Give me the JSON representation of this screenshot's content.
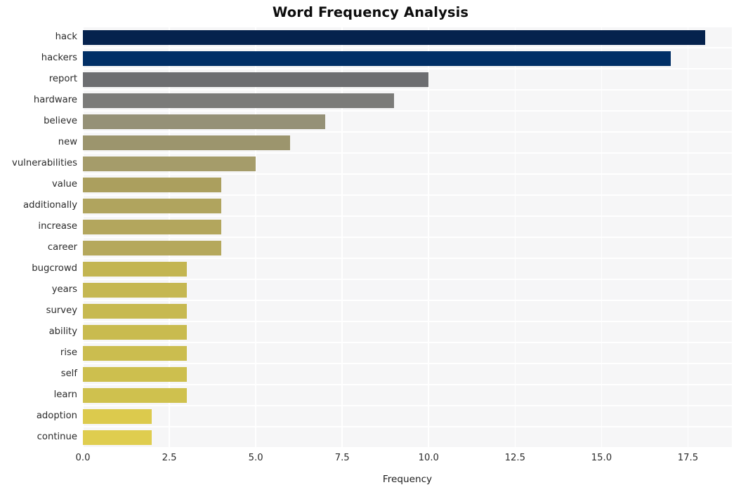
{
  "chart_data": {
    "type": "bar",
    "orientation": "horizontal",
    "title": "Word Frequency Analysis",
    "xlabel": "Frequency",
    "ylabel": "",
    "xlim": [
      0,
      18.77
    ],
    "xticks": [
      0.0,
      2.5,
      5.0,
      7.5,
      10.0,
      12.5,
      15.0,
      17.5
    ],
    "xtick_labels": [
      "0.0",
      "2.5",
      "5.0",
      "7.5",
      "10.0",
      "12.5",
      "15.0",
      "17.5"
    ],
    "grid": true,
    "legend": "none",
    "plot_background": "#f6f6f7",
    "gridline_color": "#ffffff",
    "categories": [
      "hack",
      "hackers",
      "report",
      "hardware",
      "believe",
      "new",
      "vulnerabilities",
      "value",
      "additionally",
      "increase",
      "career",
      "bugcrowd",
      "years",
      "survey",
      "ability",
      "rise",
      "self",
      "learn",
      "adoption",
      "continue"
    ],
    "values": [
      18,
      17,
      10,
      9,
      7,
      6,
      5,
      4,
      4,
      4,
      4,
      3,
      3,
      3,
      3,
      3,
      3,
      3,
      2,
      2
    ],
    "bar_colors": [
      "#05224d",
      "#012f66",
      "#6d6e71",
      "#7b7b79",
      "#959177",
      "#9c956d",
      "#a59c6a",
      "#ab9f5e",
      "#b0a45e",
      "#b3a65d",
      "#b5a85c",
      "#c3b551",
      "#c5b751",
      "#c7b950",
      "#c9bb4f",
      "#cbbd4f",
      "#cdbf4e",
      "#cfc14e",
      "#dcca4d",
      "#dfcd4f"
    ],
    "bars": [
      {
        "label": "hack",
        "value": 18,
        "color": "#05224d"
      },
      {
        "label": "hackers",
        "value": 17,
        "color": "#012f66"
      },
      {
        "label": "report",
        "value": 10,
        "color": "#6d6e71"
      },
      {
        "label": "hardware",
        "value": 9,
        "color": "#7b7b79"
      },
      {
        "label": "believe",
        "value": 7,
        "color": "#959177"
      },
      {
        "label": "new",
        "value": 6,
        "color": "#9c956d"
      },
      {
        "label": "vulnerabilities",
        "value": 5,
        "color": "#a59c6a"
      },
      {
        "label": "value",
        "value": 4,
        "color": "#ab9f5e"
      },
      {
        "label": "additionally",
        "value": 4,
        "color": "#b0a45e"
      },
      {
        "label": "increase",
        "value": 4,
        "color": "#b3a65d"
      },
      {
        "label": "career",
        "value": 4,
        "color": "#b5a85c"
      },
      {
        "label": "bugcrowd",
        "value": 3,
        "color": "#c3b551"
      },
      {
        "label": "years",
        "value": 3,
        "color": "#c5b751"
      },
      {
        "label": "survey",
        "value": 3,
        "color": "#c7b950"
      },
      {
        "label": "ability",
        "value": 3,
        "color": "#c9bb4f"
      },
      {
        "label": "rise",
        "value": 3,
        "color": "#cbbd4f"
      },
      {
        "label": "self",
        "value": 3,
        "color": "#cdbf4e"
      },
      {
        "label": "learn",
        "value": 3,
        "color": "#cfc14e"
      },
      {
        "label": "adoption",
        "value": 2,
        "color": "#dcca4d"
      },
      {
        "label": "continue",
        "value": 2,
        "color": "#dfcd4f"
      }
    ]
  }
}
